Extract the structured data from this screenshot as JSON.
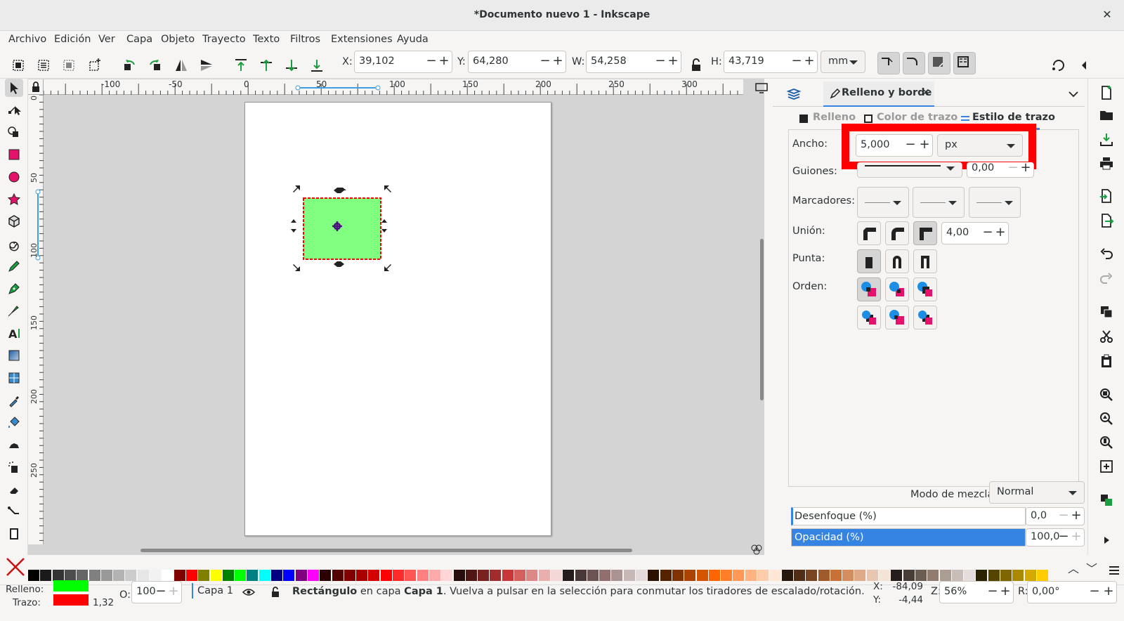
{
  "window": {
    "title": "*Documento nuevo 1 - Inkscape",
    "close_label": "✕"
  },
  "menu": [
    "Archivo",
    "Edición",
    "Ver",
    "Capa",
    "Objeto",
    "Trayecto",
    "Texto",
    "Filtros",
    "Extensiones",
    "Ayuda"
  ],
  "toolbar": {
    "x_label": "X:",
    "x_value": "39,102",
    "y_label": "Y:",
    "y_value": "64,280",
    "w_label": "W:",
    "w_value": "54,258",
    "h_label": "H:",
    "h_value": "43,719",
    "unit": "mm"
  },
  "ruler": {
    "h_ticks": [
      "-100",
      "-50",
      "0",
      "50",
      "100",
      "150",
      "200",
      "250",
      "300"
    ],
    "v_ticks": [
      "0",
      "50",
      "100",
      "150",
      "200",
      "250"
    ]
  },
  "panel": {
    "dialog_title": "Relleno y borde",
    "tabs": [
      "Relleno",
      "Color de trazo",
      "Estilo de trazo"
    ],
    "width_label": "Ancho:",
    "width_value": "5,000",
    "width_unit": "px",
    "dashes_label": "Guiones:",
    "dash_offset": "0,00",
    "markers_label": "Marcadores:",
    "join_label": "Unión:",
    "miter_value": "4,00",
    "cap_label": "Punta:",
    "order_label": "Orden:",
    "blend_label": "Modo de mezcla:",
    "blend_value": "Normal",
    "blur_label": "Desenfoque (%)",
    "blur_value": "0,0",
    "opacity_label": "Opacidad (%)",
    "opacity_value": "100,0",
    "opacity_fraction": 1.0
  },
  "status": {
    "fill_label": "Relleno:",
    "stroke_label": "Trazo:",
    "stroke_width": "1,32",
    "opacity_label": "O:",
    "opacity_value": "100",
    "layer": "Capa 1",
    "message_bold": "Rectángulo",
    "message_mid": " en capa ",
    "message_layer": "Capa 1",
    "message_rest": ". Vuelva a pulsar en la selección para conmutar los tiradores de escalado/rotación.",
    "cursor_x_label": "X:",
    "cursor_x": "-84,09",
    "cursor_y_label": "Y:",
    "cursor_y": "-4,44",
    "zoom_label": "Z:",
    "zoom_value": "56%",
    "rotate_label": "R:",
    "rotate_value": "0,00°"
  },
  "colors": {
    "rect_fill": "#80ff80",
    "rect_stroke": "#ff0000",
    "highlight": "#ff0000",
    "accent": "#3584e4",
    "fill_swatch": "#00ff00",
    "stroke_swatch": "#ff0000"
  },
  "palette_colors": [
    "#000000",
    "#1a1a1a",
    "#333333",
    "#4d4d4d",
    "#666666",
    "#808080",
    "#999999",
    "#b3b3b3",
    "#cccccc",
    "#e6e6e6",
    "#f2f2f2",
    "#ffffff",
    "#800000",
    "#ff0000",
    "#808000",
    "#ffff00",
    "#008000",
    "#00ff00",
    "#008080",
    "#00ffff",
    "#000080",
    "#0000ff",
    "#800080",
    "#ff00ff",
    "#2b0000",
    "#550000",
    "#800000",
    "#aa0000",
    "#d40000",
    "#ff0000",
    "#ff2a2a",
    "#ff5555",
    "#ff8080",
    "#ffaaaa",
    "#ffd5d5",
    "#280b0b",
    "#501616",
    "#782121",
    "#a02c2c",
    "#c83737",
    "#d35f5f",
    "#de8787",
    "#e9afaf",
    "#f4d7d7",
    "#241c1c",
    "#483737",
    "#6c5353",
    "#916f6f",
    "#ac9393",
    "#c8b7b7",
    "#e3dbdb",
    "#2b1100",
    "#552200",
    "#803300",
    "#aa4400",
    "#d45500",
    "#ff6600",
    "#ff7f2a",
    "#ff9955",
    "#ffb380",
    "#ffccaa",
    "#ffe6d5",
    "#28170b",
    "#502d16",
    "#784421",
    "#a05a2c",
    "#c87137",
    "#d38d5f",
    "#deaa87",
    "#e9c6af",
    "#f4e3d7",
    "#241f1c",
    "#483e37",
    "#6c5d53",
    "#917c6f",
    "#ac9d93",
    "#c8beb7",
    "#e3dedb",
    "#2b2200",
    "#554400",
    "#806600",
    "#aa8800",
    "#d4aa00",
    "#ffcc00"
  ]
}
